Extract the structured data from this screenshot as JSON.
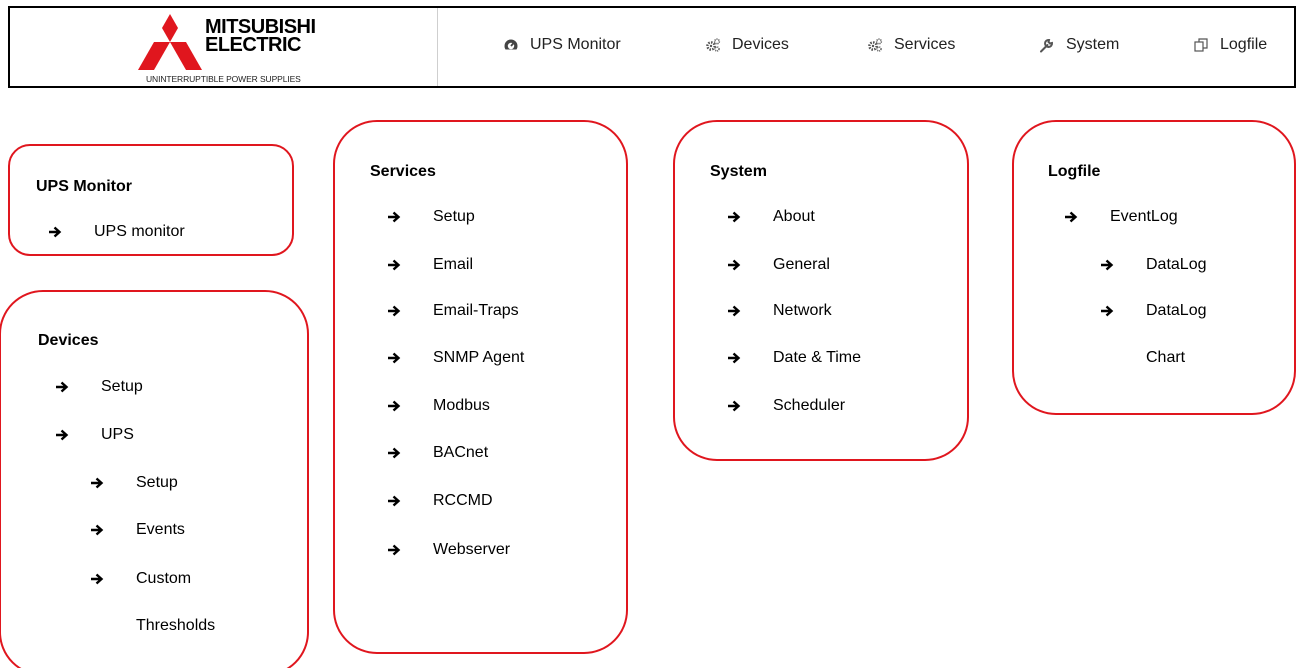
{
  "logo": {
    "wordmark_line1": "MITSUBISHI",
    "wordmark_line2": "ELECTRIC",
    "tagline": "UNINTERRUPTIBLE POWER SUPPLIES",
    "brand_color": "#e0161e"
  },
  "nav": [
    {
      "label": "UPS Monitor",
      "icon": "dashboard-icon"
    },
    {
      "label": "Devices",
      "icon": "gears-icon"
    },
    {
      "label": "Services",
      "icon": "gears-icon"
    },
    {
      "label": "System",
      "icon": "wrench-icon"
    },
    {
      "label": "Logfile",
      "icon": "copy-icon"
    }
  ],
  "menu_map": {
    "ups_monitor": {
      "title": "UPS Monitor",
      "items": [
        "UPS monitor"
      ]
    },
    "devices": {
      "title": "Devices",
      "items": [
        "Setup",
        "UPS"
      ],
      "ups_subitems": [
        "Setup",
        "Events",
        "Custom"
      ],
      "ups_subitems_continuation": "Thresholds"
    },
    "services": {
      "title": "Services",
      "items": [
        "Setup",
        "Email",
        "Email-Traps",
        "SNMP Agent",
        "Modbus",
        "BACnet",
        "RCCMD",
        "Webserver"
      ]
    },
    "system": {
      "title": "System",
      "items": [
        "About",
        "General",
        "Network",
        "Date & Time",
        "Scheduler"
      ]
    },
    "logfile": {
      "title": "Logfile",
      "items": [
        "EventLog"
      ],
      "eventlog_subitems": [
        "DataLog",
        "DataLog"
      ],
      "eventlog_subitems_continuation": "Chart"
    }
  },
  "colors": {
    "box_border": "#e0161e",
    "text": "#000000",
    "nav_text": "#222222"
  }
}
